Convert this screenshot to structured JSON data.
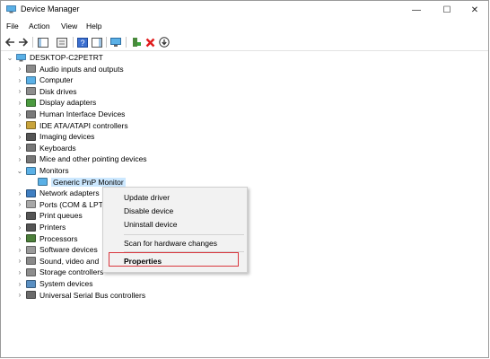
{
  "window": {
    "title": "Device Manager",
    "icon": "device-manager-icon"
  },
  "controls": {
    "minimize": "—",
    "maximize": "☐",
    "close": "✕"
  },
  "menu": [
    "File",
    "Action",
    "View",
    "Help"
  ],
  "toolbar": [
    "back-arrow-icon",
    "forward-arrow-icon",
    "show-hide-tree-icon",
    "properties-icon",
    "help-icon",
    "scan-hardware-icon",
    "add-driver-icon",
    "uninstall-x-icon",
    "download-driver-icon"
  ],
  "tree": {
    "root": "DESKTOP-C2PETRT",
    "items": [
      {
        "label": "Audio inputs and outputs",
        "icon": "speaker-icon"
      },
      {
        "label": "Computer",
        "icon": "monitor-icon"
      },
      {
        "label": "Disk drives",
        "icon": "disk-drive-icon"
      },
      {
        "label": "Display adapters",
        "icon": "display-adapter-icon"
      },
      {
        "label": "Human Interface Devices",
        "icon": "hid-icon"
      },
      {
        "label": "IDE ATA/ATAPI controllers",
        "icon": "ide-controller-icon"
      },
      {
        "label": "Imaging devices",
        "icon": "camera-icon"
      },
      {
        "label": "Keyboards",
        "icon": "keyboard-icon"
      },
      {
        "label": "Mice and other pointing devices",
        "icon": "mouse-icon"
      },
      {
        "label": "Monitors",
        "icon": "monitor-icon",
        "expanded": true
      },
      {
        "label": "Generic PnP Monitor",
        "icon": "monitor-icon",
        "child": true,
        "selected": true
      },
      {
        "label": "Network adapters",
        "icon": "network-icon"
      },
      {
        "label": "Ports (COM & LPT",
        "icon": "port-icon"
      },
      {
        "label": "Print queues",
        "icon": "printer-icon"
      },
      {
        "label": "Printers",
        "icon": "printer-icon"
      },
      {
        "label": "Processors",
        "icon": "processor-icon"
      },
      {
        "label": "Software devices",
        "icon": "software-device-icon"
      },
      {
        "label": "Sound, video and",
        "icon": "speaker-icon"
      },
      {
        "label": "Storage controllers",
        "icon": "storage-icon"
      },
      {
        "label": "System devices",
        "icon": "system-icon"
      },
      {
        "label": "Universal Serial Bus controllers",
        "icon": "usb-icon"
      }
    ]
  },
  "context_menu": {
    "update": "Update driver",
    "disable": "Disable device",
    "uninstall": "Uninstall device",
    "scan": "Scan for hardware changes",
    "properties": "Properties"
  },
  "highlight_color": "#d9363e",
  "selection_color": "#cce8ff"
}
